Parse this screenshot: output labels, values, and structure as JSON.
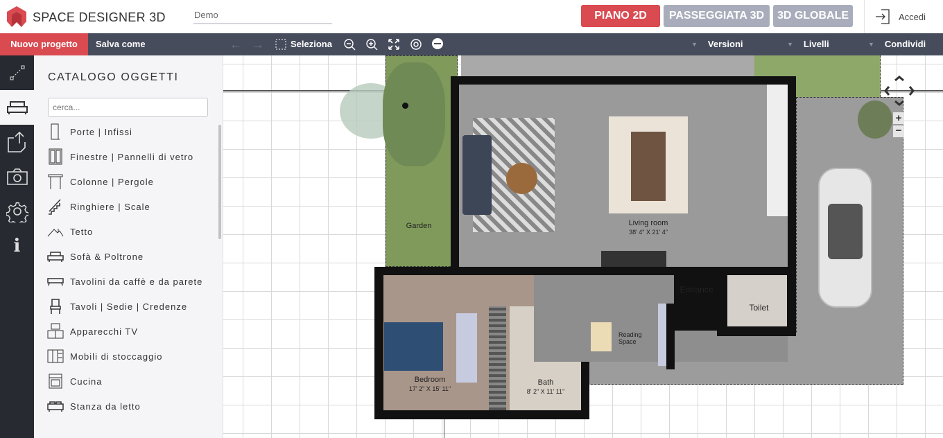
{
  "app": {
    "title": "SPACE DESIGNER 3D",
    "project_name": "Demo",
    "brand_color": "#d94a51"
  },
  "modes": [
    {
      "label": "PIANO 2D",
      "active": true
    },
    {
      "label": "PASSEGGIATA 3D",
      "active": false
    },
    {
      "label": "3D GLOBALE",
      "active": false
    }
  ],
  "login": {
    "label": "Accedi",
    "icon": "login-icon"
  },
  "toolbar": {
    "new_project": "Nuovo progetto",
    "save_as": "Salva come",
    "select": "Seleziona",
    "versions": "Versioni",
    "levels": "Livelli",
    "share": "Condividi"
  },
  "rail": [
    {
      "icon": "measure-icon"
    },
    {
      "icon": "sofa-icon",
      "active": true
    },
    {
      "icon": "export-icon"
    },
    {
      "icon": "camera-icon"
    },
    {
      "icon": "gear-icon"
    },
    {
      "icon": "info-icon"
    }
  ],
  "catalog": {
    "title": "CATALOGO OGGETTI",
    "search_placeholder": "cerca...",
    "items": [
      {
        "label": "Porte | Infissi",
        "icon": "door-icon"
      },
      {
        "label": "Finestre | Pannelli di vetro",
        "icon": "window-icon"
      },
      {
        "label": "Colonne | Pergole",
        "icon": "column-icon"
      },
      {
        "label": "Ringhiere | Scale",
        "icon": "stairs-icon"
      },
      {
        "label": "Tetto",
        "icon": "roof-icon"
      },
      {
        "label": "Sofà & Poltrone",
        "icon": "sofa-icon"
      },
      {
        "label": "Tavolini da caffè e da parete",
        "icon": "coffee-table-icon"
      },
      {
        "label": "Tavoli | Sedie | Credenze",
        "icon": "chair-icon"
      },
      {
        "label": "Apparecchi TV",
        "icon": "tv-icon"
      },
      {
        "label": "Mobili di stoccaggio",
        "icon": "storage-icon"
      },
      {
        "label": "Cucina",
        "icon": "oven-icon"
      },
      {
        "label": "Stanza da letto",
        "icon": "bed-icon"
      }
    ]
  },
  "plan": {
    "rooms": [
      {
        "name": "Garden"
      },
      {
        "name": "Living room",
        "size": "38' 4\" X 21' 4\""
      },
      {
        "name": "Entrance"
      },
      {
        "name": "Toilet"
      },
      {
        "name": "Reading Space"
      },
      {
        "name": "Bedroom",
        "size": "17' 2\" X 15' 11\""
      },
      {
        "name": "Bath",
        "size": "8' 2\" X 11' 11\""
      }
    ]
  }
}
